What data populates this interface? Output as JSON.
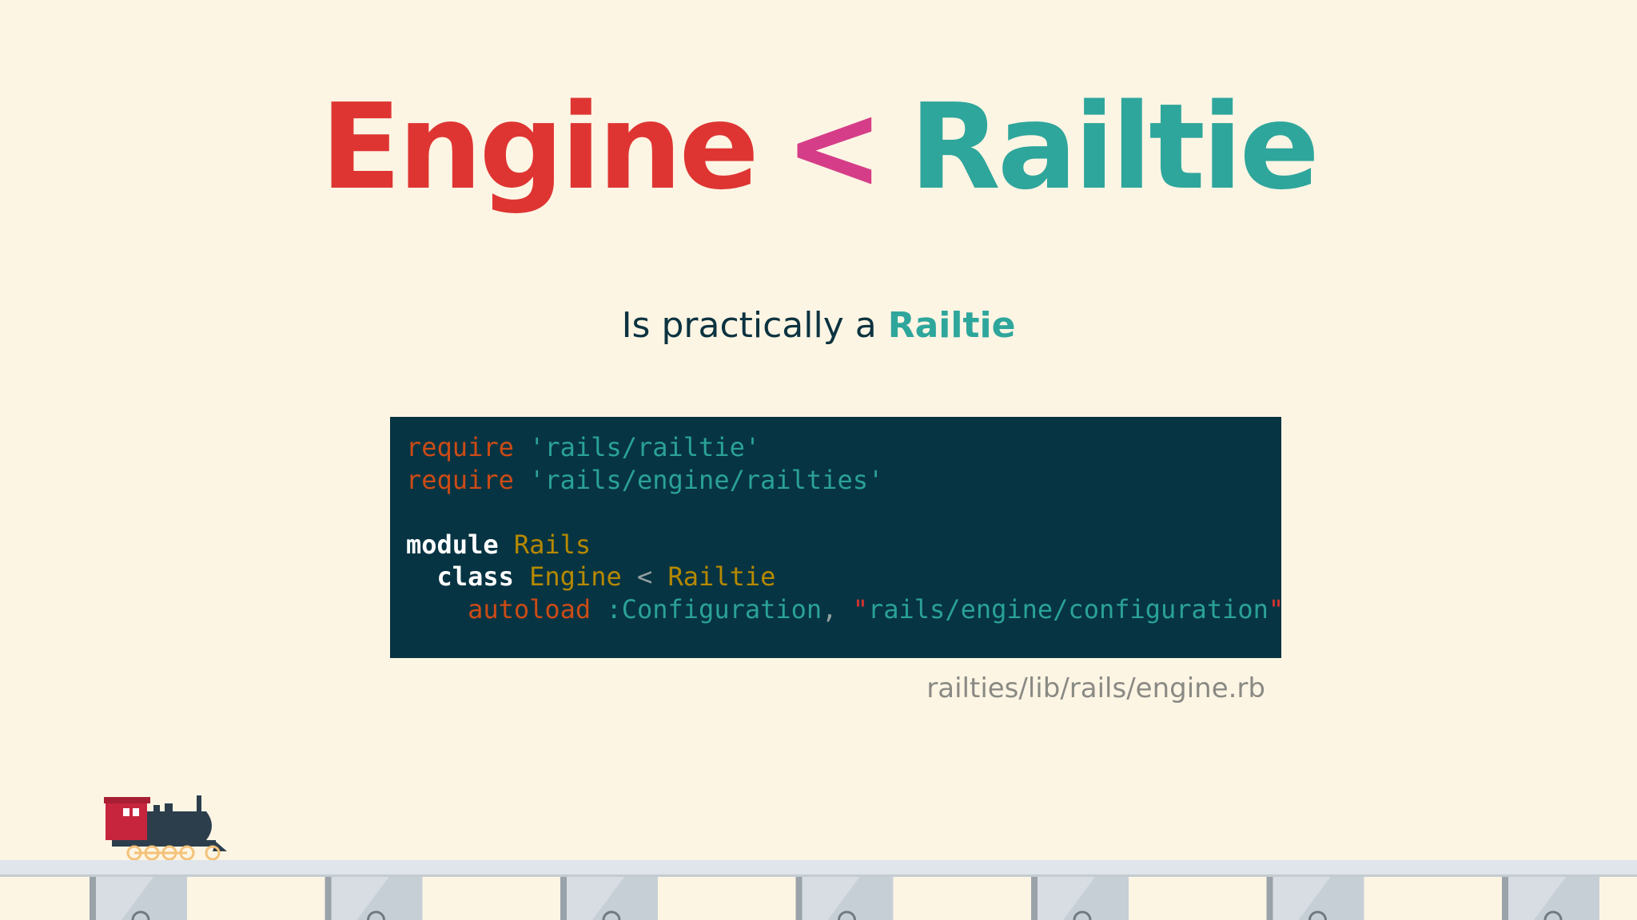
{
  "title": {
    "left": "Engine",
    "operator": "<",
    "right": "Railtie"
  },
  "subtitle": {
    "text": "Is practically a",
    "highlight": "Railtie"
  },
  "code": {
    "lines": [
      [
        {
          "t": "require",
          "c": "kw-require"
        },
        {
          "t": " ",
          "c": ""
        },
        {
          "t": "'rails/railtie'",
          "c": "str"
        }
      ],
      [
        {
          "t": "require",
          "c": "kw-require"
        },
        {
          "t": " ",
          "c": ""
        },
        {
          "t": "'rails/engine/railties'",
          "c": "str"
        }
      ],
      [],
      [
        {
          "t": "module",
          "c": "kw"
        },
        {
          "t": " ",
          "c": ""
        },
        {
          "t": "Rails",
          "c": "const"
        }
      ],
      [
        {
          "t": "  ",
          "c": ""
        },
        {
          "t": "class",
          "c": "kw"
        },
        {
          "t": " ",
          "c": ""
        },
        {
          "t": "Engine",
          "c": "const"
        },
        {
          "t": " < ",
          "c": "op"
        },
        {
          "t": "Railtie",
          "c": "const"
        }
      ],
      [
        {
          "t": "    ",
          "c": ""
        },
        {
          "t": "autoload",
          "c": "kw-require"
        },
        {
          "t": " ",
          "c": ""
        },
        {
          "t": ":Configuration",
          "c": "sym"
        },
        {
          "t": ", ",
          "c": "op"
        },
        {
          "t": "\"",
          "c": "quote"
        },
        {
          "t": "rails/engine/configuration",
          "c": "str"
        },
        {
          "t": "\"",
          "c": "quote"
        }
      ]
    ]
  },
  "caption": "railties/lib/rails/engine.rb",
  "colors": {
    "background": "#fdf5e4",
    "engine": "#de3533",
    "operator": "#d53d88",
    "railtie": "#2ea69c",
    "code_background": "#073442"
  },
  "decorations": {
    "train_icon": "steam-locomotive-icon",
    "rail_icon": "railroad-track"
  }
}
